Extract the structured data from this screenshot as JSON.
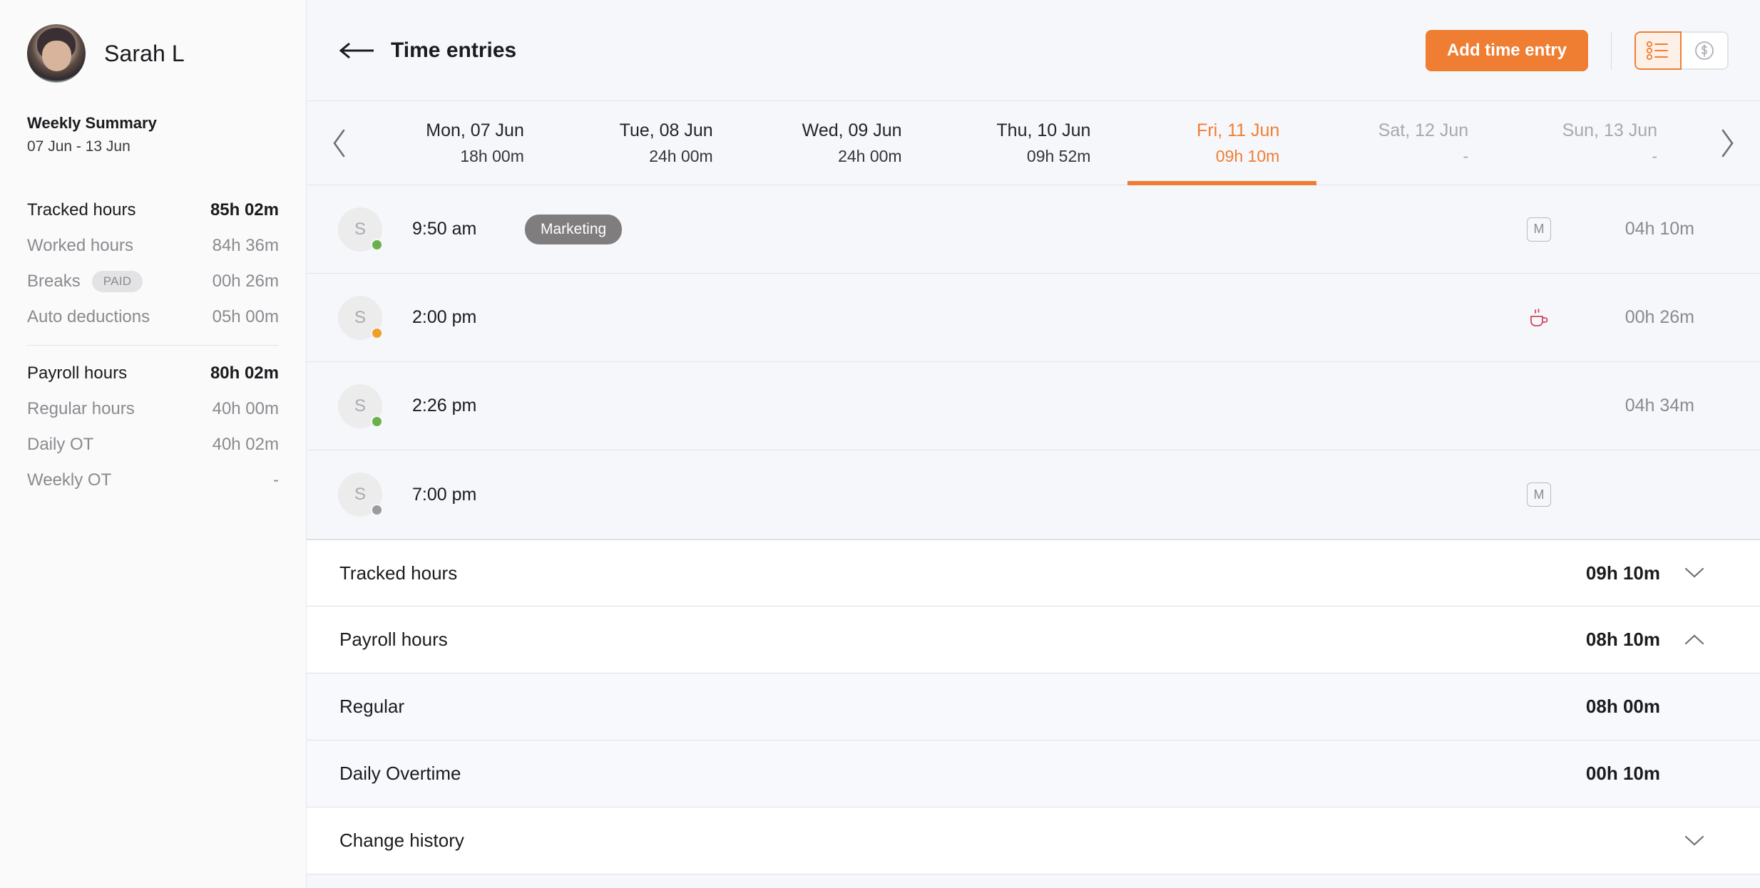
{
  "sidebar": {
    "profile": {
      "name": "Sarah L",
      "avatar_icon": "user-photo-avatar"
    },
    "summary_title": "Weekly Summary",
    "summary_range": "07 Jun - 13 Jun",
    "stats_primary": [
      {
        "label": "Tracked hours",
        "value": "85h 02m",
        "strong": true
      },
      {
        "label": "Worked hours",
        "value": "84h 36m",
        "strong": false
      },
      {
        "label": "Breaks",
        "badge": "PAID",
        "value": "00h 26m",
        "strong": false
      },
      {
        "label": "Auto deductions",
        "value": "05h 00m",
        "strong": false
      }
    ],
    "stats_secondary": [
      {
        "label": "Payroll hours",
        "value": "80h 02m",
        "strong": true
      },
      {
        "label": "Regular hours",
        "value": "40h 00m",
        "strong": false
      },
      {
        "label": "Daily OT",
        "value": "40h 02m",
        "strong": false
      },
      {
        "label": "Weekly OT",
        "value": "-",
        "strong": false
      }
    ]
  },
  "topbar": {
    "back_icon": "back-arrow-icon",
    "title": "Time entries",
    "add_button_label": "Add time entry",
    "view_toggle": [
      {
        "icon": "list-view-icon",
        "active": true
      },
      {
        "icon": "dollar-view-icon",
        "active": false
      }
    ]
  },
  "daystrip": {
    "prev_icon": "chevron-left-icon",
    "next_icon": "chevron-right-icon",
    "days": [
      {
        "name": "Mon, 07 Jun",
        "hours": "18h 00m",
        "state": "normal"
      },
      {
        "name": "Tue, 08 Jun",
        "hours": "24h 00m",
        "state": "normal"
      },
      {
        "name": "Wed, 09 Jun",
        "hours": "24h 00m",
        "state": "normal"
      },
      {
        "name": "Thu, 10 Jun",
        "hours": "09h 52m",
        "state": "normal"
      },
      {
        "name": "Fri, 11 Jun",
        "hours": "09h 10m",
        "state": "active"
      },
      {
        "name": "Sat, 12 Jun",
        "hours": "-",
        "state": "muted"
      },
      {
        "name": "Sun, 13 Jun",
        "hours": "-",
        "state": "muted"
      }
    ]
  },
  "entries": [
    {
      "initial": "S",
      "status_color": "#6ab04c",
      "time": "9:50 am",
      "tag": "Marketing",
      "icon": "manual-entry-badge",
      "icon_label": "M",
      "duration": "04h 10m"
    },
    {
      "initial": "S",
      "status_color": "#f0a02a",
      "time": "2:00 pm",
      "tag": "",
      "icon": "coffee-break-icon",
      "icon_label": "",
      "duration": "00h 26m"
    },
    {
      "initial": "S",
      "status_color": "#6ab04c",
      "time": "2:26 pm",
      "tag": "",
      "icon": "none",
      "icon_label": "",
      "duration": "04h 34m"
    },
    {
      "initial": "S",
      "status_color": "#9b9b9e",
      "time": "7:00 pm",
      "tag": "",
      "icon": "manual-entry-badge",
      "icon_label": "M",
      "duration": ""
    }
  ],
  "summary_rows": [
    {
      "label": "Tracked hours",
      "value": "09h 10m",
      "chevron": "chevron-down-icon",
      "sub": false
    },
    {
      "label": "Payroll hours",
      "value": "08h 10m",
      "chevron": "chevron-up-icon",
      "sub": false
    },
    {
      "label": "Regular",
      "value": "08h 00m",
      "chevron": "none",
      "sub": true
    },
    {
      "label": "Daily Overtime",
      "value": "00h 10m",
      "chevron": "none",
      "sub": true
    },
    {
      "label": "Change history",
      "value": "",
      "chevron": "chevron-down-icon",
      "sub": false
    }
  ],
  "colors": {
    "accent": "#ef7e33",
    "accent_soft": "#fdf0e6",
    "tag_gray": "#7f7d7e",
    "break_red": "#d4455f"
  }
}
